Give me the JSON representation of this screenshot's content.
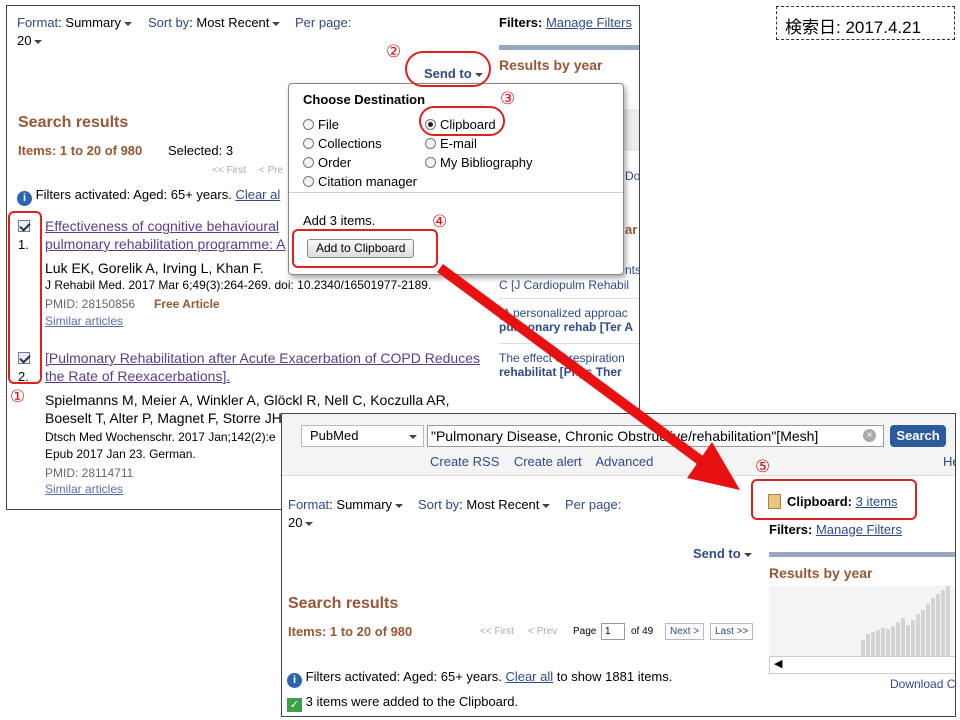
{
  "date_label": "検索日: 2017.4.21",
  "top": {
    "format_label": "Format",
    "format_value": "Summary",
    "sort_label": "Sort by",
    "sort_value": "Most Recent",
    "perpage_label": "Per page:",
    "perpage_value": "20",
    "send_to": "Send to",
    "search_results": "Search results",
    "items": "Items: 1 to 20 of 980",
    "selected": "Selected: 3",
    "first": "<< First",
    "prev": "< Pre",
    "filters_text": "Filters activated: Aged: 65+ years.",
    "clear_all": "Clear al",
    "filters_label": "Filters:",
    "manage_filters": "Manage Filters",
    "results_by_year": "Results by year",
    "right_dov": "Dov",
    "right_ar": "ar",
    "right_nts": "nts",
    "right_snip1": "C [J Cardiopulm Rehabil",
    "right_snip2a": "[A personalized approac",
    "right_snip2b": "pulmonary rehab [Ter A",
    "right_snip3a": "The effect of respiration",
    "right_snip3b": "rehabilitat [Phys Ther",
    "articles": [
      {
        "num": "1.",
        "title1": "Effectiveness of cognitive behavioural",
        "title2": "pulmonary rehabilitation programme: A",
        "authors": "Luk EK, Gorelik A, Irving L, Khan F.",
        "journal": "J Rehabil Med. 2017 Mar 6;49(3):264-269. doi: 10.2340/16501977-2189.",
        "pmid": "PMID: 28150856",
        "free": "Free Article",
        "similar": "Similar articles"
      },
      {
        "num": "2.",
        "title1": "[Pulmonary Rehabilitation after Acute Exacerbation of COPD Reduces",
        "title2": "the Rate of Reexacerbations].",
        "authors": "Spielmanns M, Meier A, Winkler A, Glöckl R, Nell C, Koczulla AR,",
        "authors2": "Boeselt T, Alter P, Magnet F, Storre JH",
        "journal": "Dtsch Med Wochenschr. 2017 Jan;142(2):e",
        "journal2": "Epub 2017 Jan 23. German.",
        "pmid": "PMID: 28114711",
        "similar": "Similar articles"
      }
    ]
  },
  "popup": {
    "title": "Choose Destination",
    "options_left": [
      "File",
      "Collections",
      "Order",
      "Citation manager"
    ],
    "options_right": [
      "Clipboard",
      "E-mail",
      "My Bibliography"
    ],
    "selected": "Clipboard",
    "add_text": "Add 3 items.",
    "button": "Add to Clipboard"
  },
  "bottom": {
    "db": "PubMed",
    "query": "\"Pulmonary Disease, Chronic Obstructive/rehabilitation\"[Mesh]",
    "search": "Search",
    "links": [
      "Create RSS",
      "Create alert",
      "Advanced"
    ],
    "he": "He",
    "format_label": "Format",
    "format_value": "Summary",
    "sort_label": "Sort by",
    "sort_value": "Most Recent",
    "perpage_label": "Per page:",
    "perpage_value": "20",
    "send_to": "Send to",
    "search_results": "Search results",
    "items": "Items: 1 to 20 of 980",
    "first": "<< First",
    "prev": "< Prev",
    "page_label": "Page",
    "page_value": "1",
    "of": "of 49",
    "next": "Next >",
    "last": "Last >>",
    "filters_text": "Filters activated: Aged: 65+ years.",
    "clear_all": "Clear all",
    "filters_tail": "to show 1881 items.",
    "added": "3 items were added to the Clipboard.",
    "clipboard_label": "Clipboard:",
    "clipboard_link": "3 items",
    "filters_label": "Filters:",
    "manage_filters": "Manage Filters",
    "results_by_year": "Results by year",
    "download": "Download C"
  },
  "annotations": [
    "①",
    "②",
    "③",
    "④",
    "⑤"
  ],
  "colors": {
    "accent_red": "#e02020",
    "header_brown": "#985735",
    "link_blue": "#2f4a8a"
  }
}
